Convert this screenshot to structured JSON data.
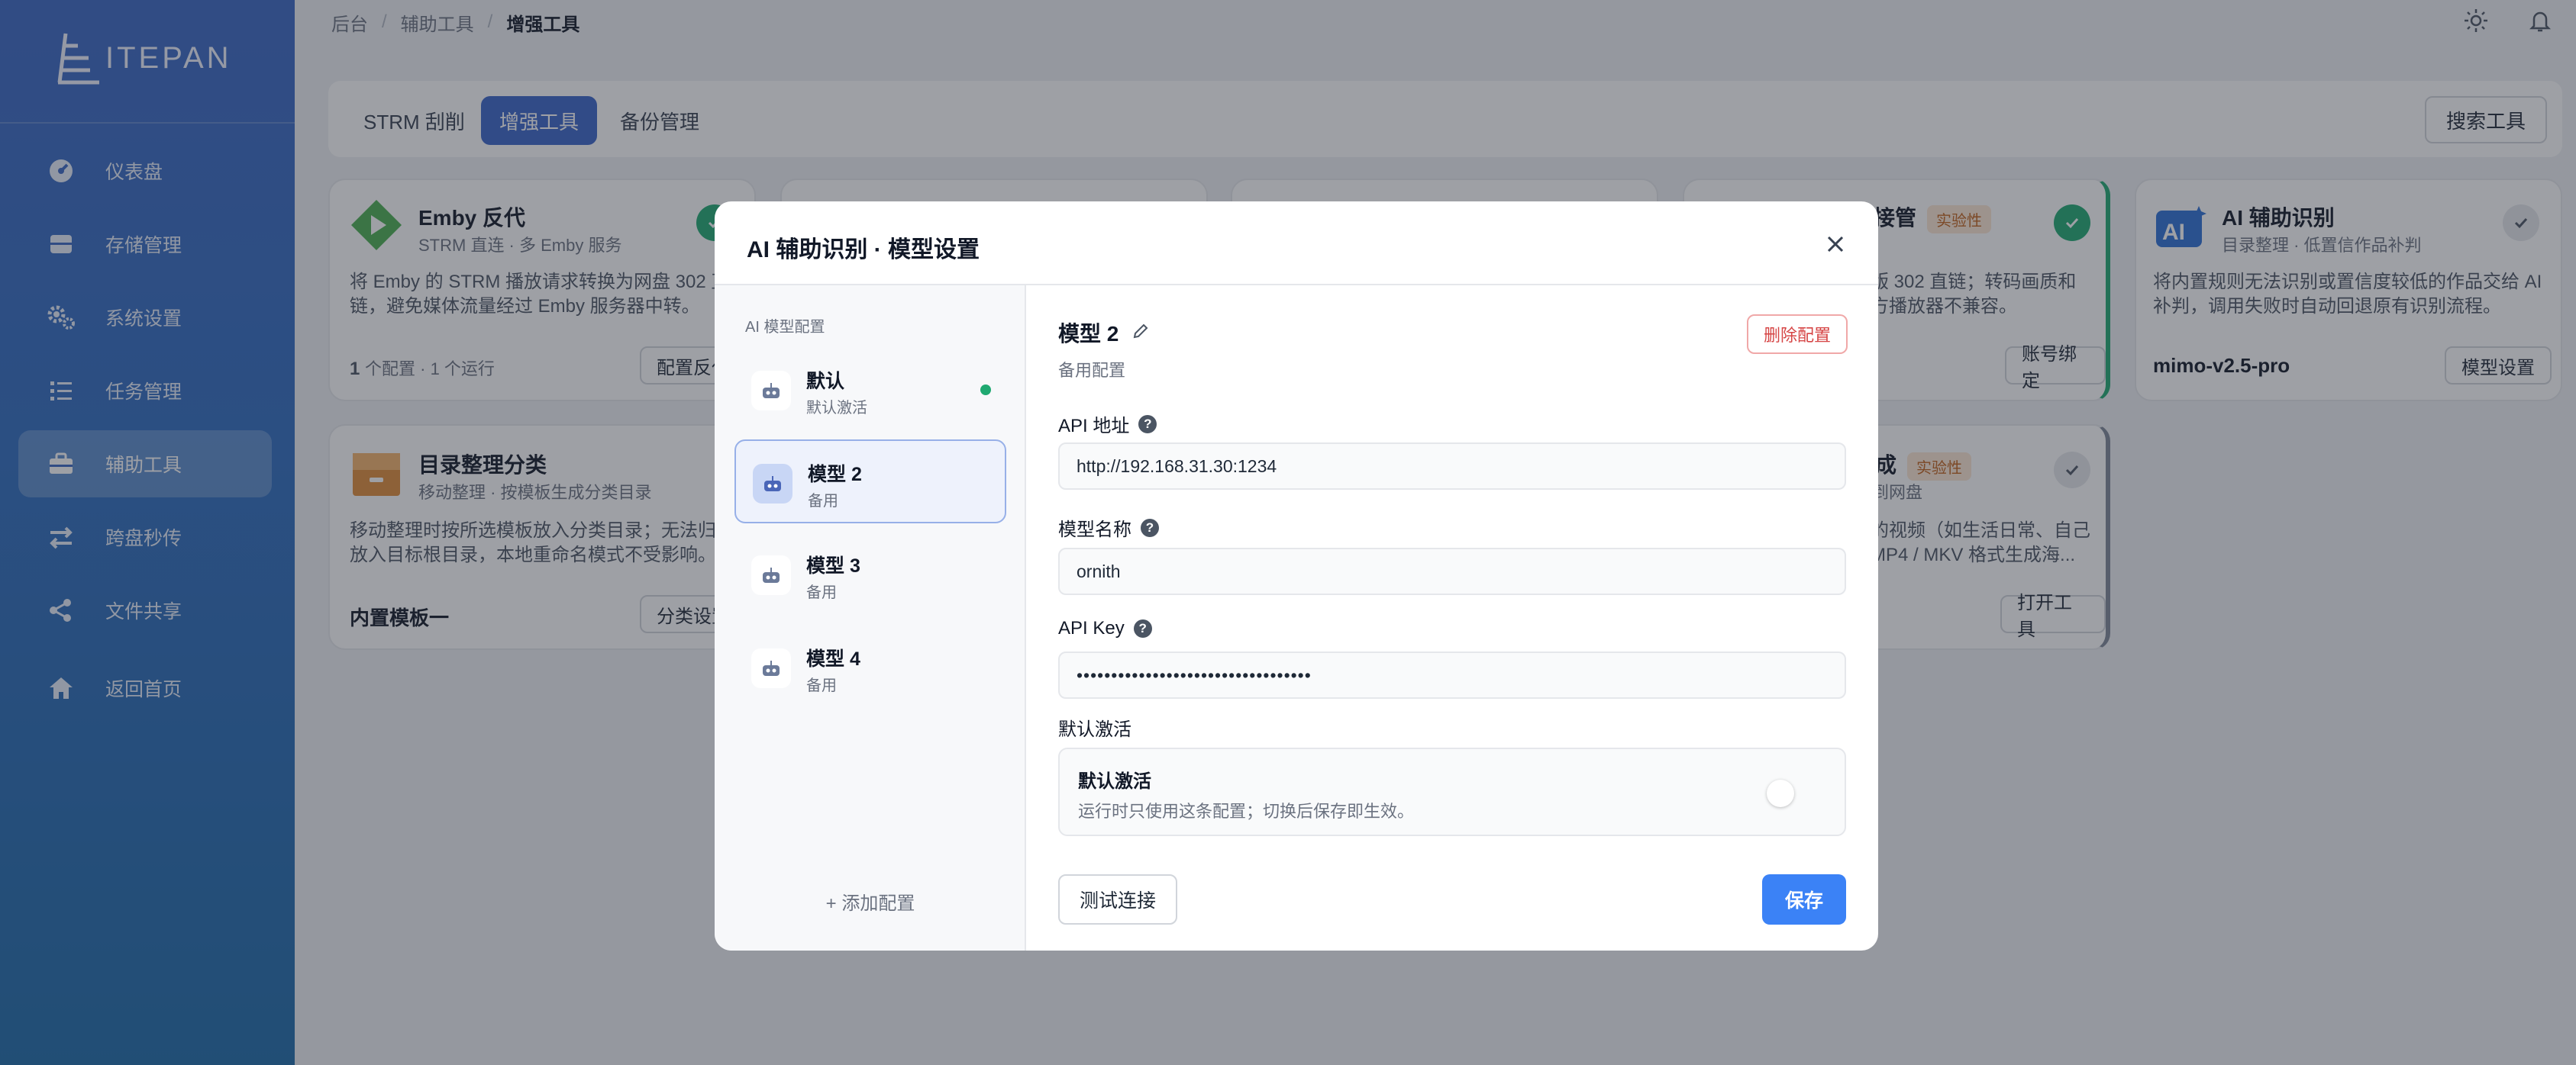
{
  "brand": {
    "logo_text": "ITEPAN"
  },
  "sidebar": {
    "items": [
      {
        "label": "仪表盘",
        "icon": "dashboard-icon"
      },
      {
        "label": "存储管理",
        "icon": "storage-icon"
      },
      {
        "label": "系统设置",
        "icon": "gear-icon"
      },
      {
        "label": "任务管理",
        "icon": "task-list-icon"
      },
      {
        "label": "辅助工具",
        "icon": "toolbox-icon",
        "active": true
      },
      {
        "label": "跨盘秒传",
        "icon": "transfer-icon"
      },
      {
        "label": "文件共享",
        "icon": "share-icon"
      },
      {
        "label": "返回首页",
        "icon": "home-icon"
      }
    ]
  },
  "breadcrumb": {
    "root": "后台",
    "parent": "辅助工具",
    "current": "增强工具"
  },
  "topbar": {
    "icons": [
      "sun-icon",
      "bell-icon"
    ]
  },
  "tabs": {
    "items": [
      "STRM 刮削",
      "增强工具",
      "备份管理"
    ],
    "active": "增强工具",
    "search_button": "搜索工具"
  },
  "cards": {
    "emby": {
      "title": "Emby 反代",
      "subtitle": "STRM 直连 · 多 Emby 服务",
      "desc_line1": "将 Emby 的 STRM 播放请求转换为网盘 302 直",
      "desc_line2": "链，避免媒体流量经过 Emby 服务器中转。",
      "foot_count": "1",
      "foot_text": "个配置 · 1 个运行",
      "button": "配置反代"
    },
    "takeover": {
      "title": "接管",
      "badge": "实验性",
      "desc_line1": "版 302 直链；转码画质和",
      "desc_line2": "方播放器不兼容。",
      "button": "账号绑定"
    },
    "ai": {
      "title": "AI 辅助识别",
      "subtitle": "目录整理 · 低置信作品补判",
      "desc_line1": "将内置规则无法识别或置信度较低的作品交给 AI",
      "desc_line2": "补判，调用失败时自动回退原有识别流程。",
      "foot": "mimo-v2.5-pro",
      "button": "模型设置"
    },
    "dir": {
      "title": "目录整理分类",
      "subtitle": "移动整理 · 按模板生成分类目录",
      "desc_line1": "移动整理时按所选模板放入分类目录；无法归类",
      "desc_line2": "放入目标根目录，本地重命名模式不受影响。",
      "foot": "内置模板一",
      "button": "分类设置"
    },
    "convert": {
      "title": "成",
      "badge": "实验性",
      "subtitle": "到网盘",
      "desc_line1": "的视频（如生活日常、自己",
      "desc_line2": "MP4 / MKV 格式生成海...",
      "button": "打开工具"
    }
  },
  "modal": {
    "title": "AI 辅助识别 · 模型设置",
    "left_label": "AI 模型配置",
    "models": [
      {
        "name": "默认",
        "status": "默认激活",
        "active_dot": true
      },
      {
        "name": "模型 2",
        "status": "备用",
        "selected": true
      },
      {
        "name": "模型 3",
        "status": "备用"
      },
      {
        "name": "模型 4",
        "status": "备用"
      }
    ],
    "add_config": "+ 添加配置",
    "detail": {
      "name": "模型 2",
      "subtitle": "备用配置",
      "delete_button": "删除配置",
      "api_url_label": "API 地址",
      "api_url_value": "http://192.168.31.30:1234",
      "model_name_label": "模型名称",
      "model_name_value": "ornith",
      "api_key_label": "API Key",
      "api_key_value": "••••••••••••••••••••••••••••••••••",
      "default_label": "默认激活",
      "toggle_title": "默认激活",
      "toggle_desc": "运行时只使用这条配置；切换后保存即生效。",
      "toggle_on": false,
      "test_button": "测试连接",
      "save_button": "保存"
    }
  },
  "colors": {
    "sidebar_top": "#3a66c4",
    "sidebar_bottom": "#1d6aa8",
    "primary": "#3b82f6",
    "active_tab": "#3a64c8",
    "success": "#1fa971",
    "danger": "#d64545",
    "badge_bg": "#fde7d4"
  }
}
